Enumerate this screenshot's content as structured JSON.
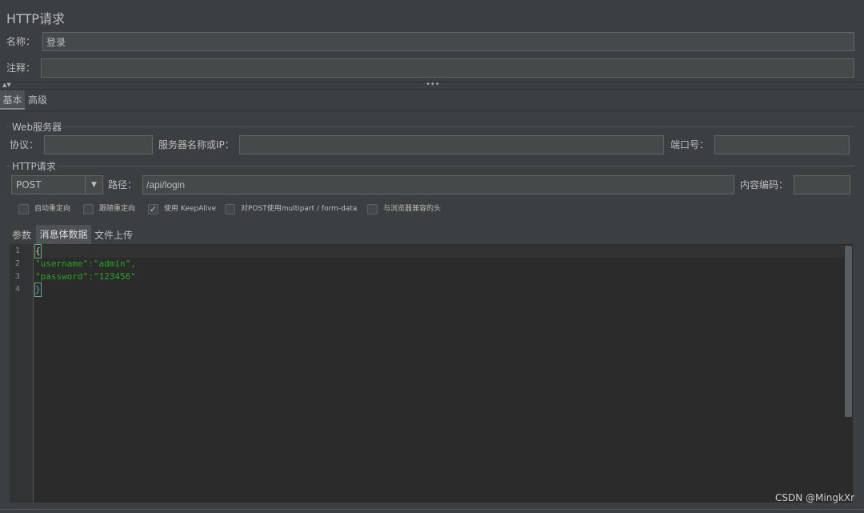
{
  "title": "HTTP请求",
  "name_label": "名称：",
  "name_value": "登录",
  "comment_label": "注释：",
  "comment_value": "",
  "tabs": [
    {
      "label": "基本",
      "active": true
    },
    {
      "label": "高级",
      "active": false
    }
  ],
  "web_server": {
    "legend": "Web服务器",
    "protocol_label": "协议：",
    "protocol_value": "",
    "server_label": "服务器名称或IP：",
    "server_value": "",
    "port_label": "端口号：",
    "port_value": ""
  },
  "http_request": {
    "legend": "HTTP请求",
    "method": "POST",
    "path_label": "路径：",
    "path_value": "/api/login",
    "encoding_label": "内容编码：",
    "encoding_value": ""
  },
  "checkboxes": [
    {
      "label": "自动重定向",
      "checked": false
    },
    {
      "label": "跟随重定向",
      "checked": false
    },
    {
      "label": "使用 KeepAlive",
      "checked": true
    },
    {
      "label": "对POST使用multipart / form-data",
      "checked": false
    },
    {
      "label": "与浏览器兼容的头",
      "checked": false
    }
  ],
  "sub_tabs": [
    {
      "label": "参数",
      "active": false
    },
    {
      "label": "消息体数据",
      "active": true
    },
    {
      "label": "文件上传",
      "active": false
    }
  ],
  "body_lines": [
    "{",
    "\"username\":\"admin\",",
    "\"password\":\"123456\"",
    "}"
  ],
  "line_numbers": [
    "1",
    "2",
    "3",
    "4"
  ],
  "watermark": "CSDN @MingkXr"
}
